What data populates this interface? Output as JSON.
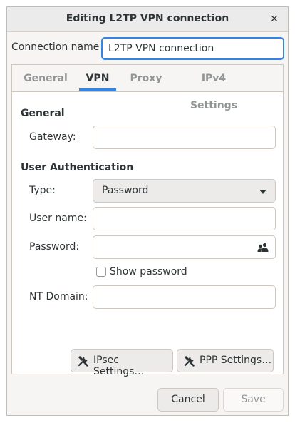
{
  "window": {
    "title": "Editing L2TP VPN connection",
    "close_glyph": "✕"
  },
  "connection_name": {
    "label": "Connection name",
    "value": "L2TP VPN connection"
  },
  "tabs": [
    {
      "label": "General"
    },
    {
      "label": "VPN",
      "active": true
    },
    {
      "label": "Proxy"
    },
    {
      "label": "IPv4 Settings"
    }
  ],
  "vpn": {
    "general_heading": "General",
    "gateway": {
      "label": "Gateway:",
      "value": ""
    },
    "auth_heading": "User Authentication",
    "type": {
      "label": "Type:",
      "value": "Password"
    },
    "username": {
      "label": "User name:",
      "value": ""
    },
    "password": {
      "label": "Password:",
      "value": "",
      "icon": "user-group-icon"
    },
    "show_password": {
      "label": "Show password",
      "checked": false
    },
    "nt_domain": {
      "label": "NT Domain:",
      "value": ""
    },
    "ipsec_button": {
      "label": "IPsec Settings…",
      "icon": "tools-icon"
    },
    "ppp_button": {
      "label": "PPP Settings…",
      "icon": "tools-icon"
    }
  },
  "footer": {
    "cancel_label": "Cancel",
    "save_label": "Save",
    "save_enabled": false
  },
  "colors": {
    "accent": "#3584e4",
    "dialog_bg": "#f6f5f4",
    "text": "#2e3436",
    "inactive_tab": "#929595"
  }
}
